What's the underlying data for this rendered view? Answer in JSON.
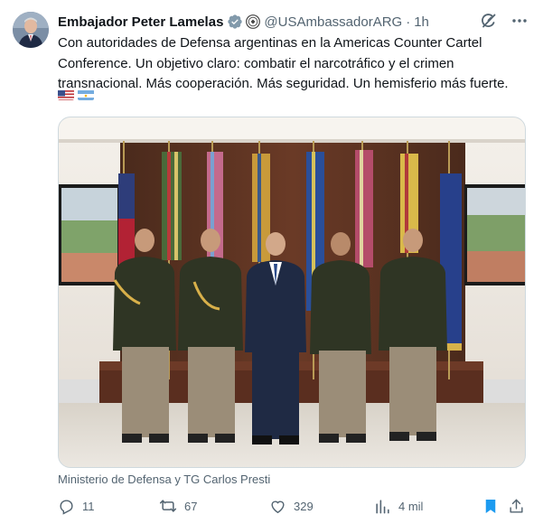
{
  "author": {
    "display_name": "Embajador Peter Lamelas",
    "handle": "@USAmbassadorARG",
    "time": "1h",
    "separator": "·"
  },
  "tweet": {
    "text": "Con autoridades de Defensa argentinas en la Americas Counter Cartel Conference. Un objetivo claro: combatir el narcotráfico y el crimen transnacional. Más cooperación. Más seguridad. Un hemisferio más fuerte.",
    "flags": [
      "us-flag",
      "argentina-flag"
    ]
  },
  "media": {
    "caption": "Ministerio de Defensa y TG Carlos Presti"
  },
  "metrics": {
    "replies": "11",
    "reposts": "67",
    "likes": "329",
    "views": "4 mil"
  },
  "icons": {
    "verified": "verified-badge-icon",
    "seal": "government-seal-icon",
    "grok": "grok-icon",
    "more": "more-icon",
    "reply": "reply-icon",
    "repost": "repost-icon",
    "like": "like-icon",
    "views": "views-icon",
    "bookmark": "bookmark-icon",
    "share": "share-icon"
  },
  "colors": {
    "text": "#0f1419",
    "secondary": "#536471",
    "accent": "#1d9bf0",
    "verified": "#829aab"
  }
}
